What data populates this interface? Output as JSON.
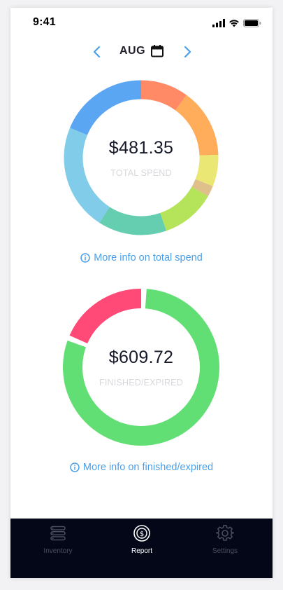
{
  "status_bar": {
    "time": "9:41"
  },
  "month_nav": {
    "month": "AUG"
  },
  "spend": {
    "amount": "$481.35",
    "label": "TOTAL SPEND",
    "link": "More info on total spend",
    "segment_colors": [
      "#ff8a65",
      "#ffad5b",
      "#ebe774",
      "#dfc08a",
      "#b5e45a",
      "#65cdb0",
      "#81cce9",
      "#5aa6f2"
    ],
    "segment_values": [
      0.1,
      0.144,
      0.066,
      0.023,
      0.114,
      0.144,
      0.222,
      0.187
    ]
  },
  "finished": {
    "amount": "$609.72",
    "label": "FINISHED/EXPIRED",
    "link": "More info on finished/expired",
    "segment_colors": [
      "#62df74",
      "#ff4a77"
    ],
    "segment_values": [
      0.805,
      0.195
    ]
  },
  "tab_bar": {
    "tabs": [
      {
        "label": "Inventory",
        "icon": "list-icon"
      },
      {
        "label": "Report",
        "icon": "dollar-coin-icon"
      },
      {
        "label": "Settings",
        "icon": "gear-icon"
      }
    ]
  }
}
